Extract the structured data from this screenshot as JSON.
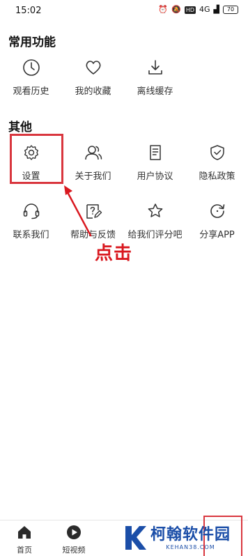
{
  "status_bar": {
    "time": "15:02",
    "network": "4G",
    "hd": "HD",
    "battery": "70"
  },
  "sections": [
    {
      "title": "常用功能",
      "items": [
        {
          "label": "观看历史",
          "icon": "clock-icon"
        },
        {
          "label": "我的收藏",
          "icon": "heart-icon"
        },
        {
          "label": "离线缓存",
          "icon": "download-icon"
        }
      ]
    },
    {
      "title": "其他",
      "items": [
        {
          "label": "设置",
          "icon": "gear-icon"
        },
        {
          "label": "关于我们",
          "icon": "people-icon"
        },
        {
          "label": "用户协议",
          "icon": "document-icon"
        },
        {
          "label": "隐私政策",
          "icon": "shield-check-icon"
        },
        {
          "label": "联系我们",
          "icon": "headset-icon"
        },
        {
          "label": "帮助与反馈",
          "icon": "help-edit-icon"
        },
        {
          "label": "给我们评分吧",
          "icon": "star-icon"
        },
        {
          "label": "分享APP",
          "icon": "share-refresh-icon"
        }
      ]
    }
  ],
  "annotation": {
    "text": "点击",
    "color": "#d9181f"
  },
  "bottom_nav": [
    {
      "label": "首页",
      "icon": "home-icon"
    },
    {
      "label": "短视频",
      "icon": "play-icon"
    }
  ],
  "watermark": {
    "title": "柯翰软件园",
    "domain": "KEHAN38.COM"
  },
  "colors": {
    "annotation_red": "#d9363e",
    "watermark_blue": "#1b4ea8"
  }
}
